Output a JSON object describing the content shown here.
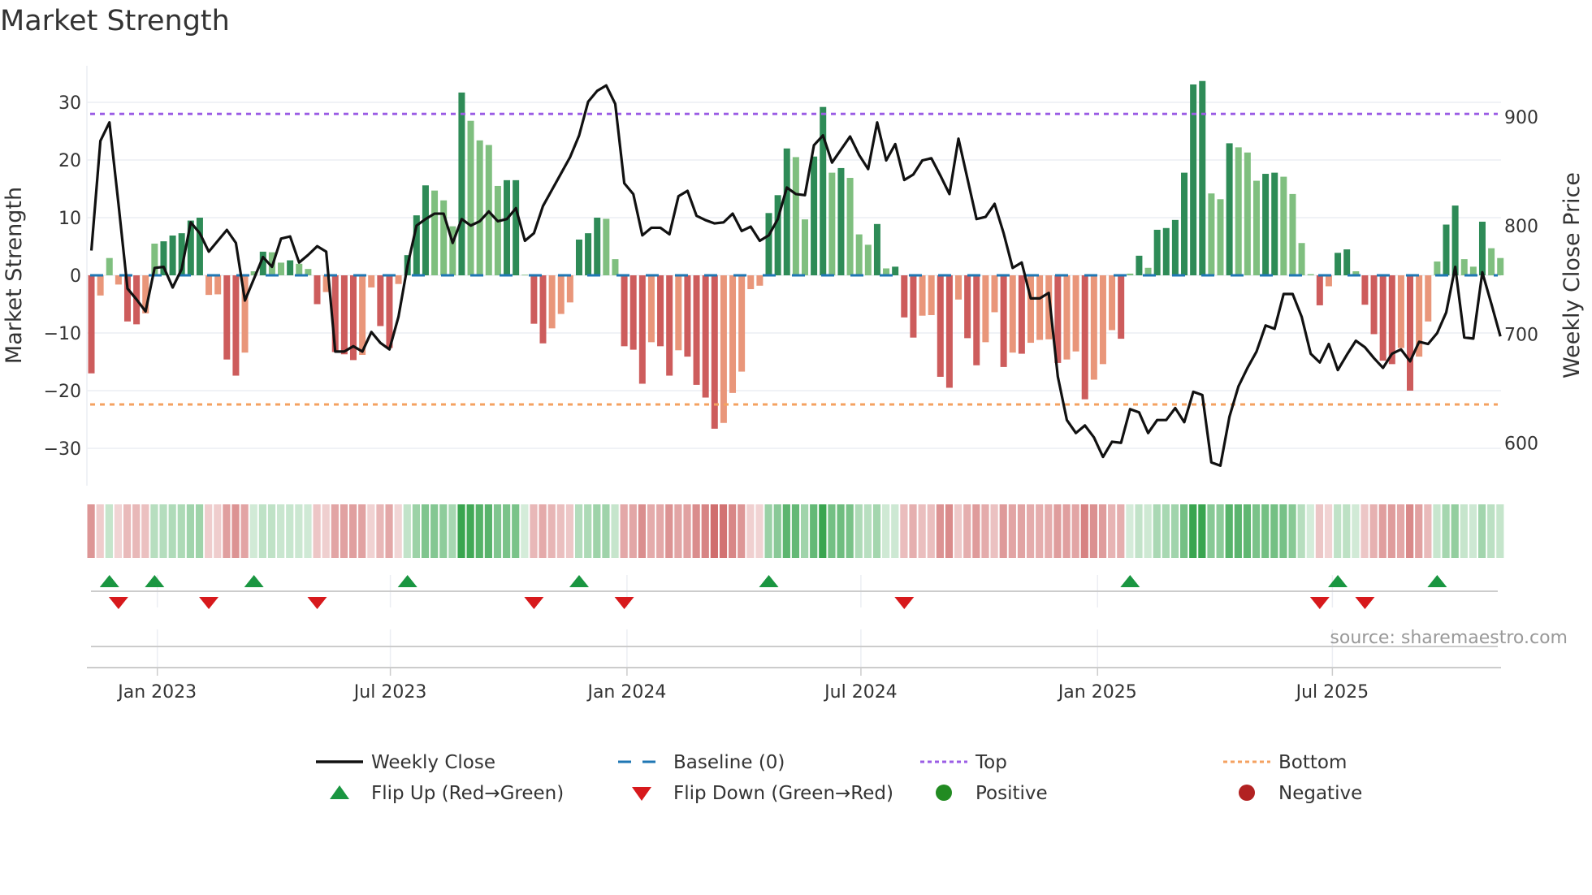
{
  "title": "Market Strength",
  "source": "source: sharemaestro.com",
  "colors": {
    "strong_green": "#2e8b57",
    "weak_green": "#7fbf7f",
    "strong_red": "#cd5c5c",
    "weak_red": "#e9967a",
    "baseline": "#1f77b4",
    "top": "#9b5de5",
    "bottom": "#f4a261",
    "close": "#111111",
    "flip_up": "#1a9641",
    "flip_down": "#d7191c"
  },
  "legend": [
    {
      "label": "Weekly Close"
    },
    {
      "label": "Baseline (0)"
    },
    {
      "label": "Top"
    },
    {
      "label": "Bottom"
    },
    {
      "label": "Flip Up (Red→Green)"
    },
    {
      "label": "Flip Down (Green→Red)"
    },
    {
      "label": "Positive"
    },
    {
      "label": "Negative"
    }
  ],
  "chart_data": {
    "type": "bar",
    "title": "Market Strength",
    "ylabel": "Market Strength",
    "y2label": "Weekly Close Price",
    "ylim": [
      -36.5,
      37
    ],
    "y2lim": [
      570,
      940
    ],
    "yticks": [
      30,
      20,
      10,
      0,
      -10,
      -20,
      -30
    ],
    "yticklabels": [
      "30",
      "20",
      "10",
      "0",
      "−10",
      "−20",
      "−30"
    ],
    "y2ticks": [
      900,
      800,
      700,
      600
    ],
    "y2ticklabels": [
      "900",
      "800",
      "700",
      "600"
    ],
    "xticks": [
      {
        "week": 7.3,
        "label": "Jan 2023"
      },
      {
        "week": 33.1,
        "label": "Jul 2023"
      },
      {
        "week": 59.3,
        "label": "Jan 2024"
      },
      {
        "week": 85.2,
        "label": "Jul 2024"
      },
      {
        "week": 111.4,
        "label": "Jan 2025"
      },
      {
        "week": 137.4,
        "label": "Jul 2025"
      }
    ],
    "top_level": 28,
    "bottom_level": -22.4,
    "baseline": 0,
    "strength": [
      -17,
      -3.5,
      3,
      -1.6,
      -8,
      -8.5,
      -6.6,
      5.5,
      5.9,
      6.9,
      7.3,
      9.5,
      10,
      -3.4,
      -3.3,
      -14.6,
      -17.4,
      -13.4,
      0.7,
      4.1,
      4,
      2.2,
      2.6,
      2,
      1.1,
      -5,
      -2.9,
      -13.3,
      -13.7,
      -14.7,
      -13.8,
      -2.1,
      -8.8,
      -12.6,
      -1.5,
      3.5,
      10.4,
      15.6,
      14.7,
      13,
      8.5,
      31.7,
      26.8,
      23.4,
      22.6,
      15.5,
      16.5,
      16.5,
      0.1,
      -8.4,
      -11.8,
      -9.2,
      -6.7,
      -4.7,
      6.2,
      7.3,
      10,
      9.8,
      2.8,
      -12.3,
      -12.9,
      -18.8,
      -11.6,
      -12.3,
      -17.4,
      -13,
      -14.1,
      -19,
      -21.2,
      -26.6,
      -25.6,
      -20.4,
      -16.7,
      -2.4,
      -1.8,
      10.8,
      13.9,
      22,
      20.5,
      9.7,
      20.6,
      29.2,
      17.8,
      18.6,
      16.9,
      7.1,
      5.3,
      8.9,
      1.2,
      1.5,
      -7.3,
      -10.8,
      -7,
      -6.9,
      -17.6,
      -19.5,
      -4.2,
      -10.9,
      -15.6,
      -11.6,
      -6.4,
      -15.9,
      -13.4,
      -13.6,
      -11.7,
      -11.2,
      -11.1,
      -15.2,
      -14.6,
      -13.2,
      -21.5,
      -18.1,
      -15.4,
      -9.5,
      -11,
      0.3,
      3.4,
      1.3,
      7.9,
      8.2,
      9.6,
      17.8,
      33.1,
      33.7,
      14.2,
      13.2,
      22.9,
      22.2,
      21.3,
      16.4,
      17.6,
      17.8,
      17.1,
      14.1,
      5.6,
      0.2,
      -5.2,
      -1.9,
      3.9,
      4.5,
      0.7,
      -5.1,
      -10.2,
      -14.8,
      -15.4,
      -12.6,
      -20,
      -14.1,
      -8,
      2.4,
      8.8,
      12.1,
      2.8,
      1.5,
      9.3,
      4.7,
      3
    ],
    "weekly_close": [
      777,
      878,
      895,
      820,
      742,
      732,
      721,
      761,
      762,
      743,
      760,
      803,
      793,
      776,
      786,
      796,
      784,
      731,
      751,
      771,
      762,
      788,
      790,
      766,
      773,
      781,
      776,
      684,
      684,
      689,
      684,
      702,
      692,
      686,
      716,
      763,
      800,
      806,
      811,
      811,
      784,
      806,
      800,
      804,
      813,
      804,
      806,
      816,
      786,
      793,
      818,
      833,
      848,
      863,
      883,
      914,
      924,
      929,
      912,
      839,
      829,
      791,
      798,
      798,
      792,
      827,
      832,
      809,
      805,
      802,
      803,
      811,
      795,
      799,
      786,
      791,
      806,
      835,
      829,
      828,
      874,
      883,
      858,
      870,
      882,
      865,
      852,
      895,
      860,
      875,
      842,
      847,
      860,
      862,
      846,
      829,
      880,
      843,
      806,
      808,
      820,
      793,
      761,
      766,
      733,
      733,
      738,
      661,
      621,
      609,
      616,
      605,
      587,
      601,
      600,
      631,
      628,
      609,
      621,
      621,
      632,
      619,
      647,
      644,
      582,
      579,
      624,
      652,
      669,
      684,
      708,
      705,
      737,
      737,
      716,
      682,
      674,
      691,
      667,
      681,
      694,
      688,
      678,
      669,
      682,
      686,
      675,
      693,
      691,
      701,
      720,
      762,
      697,
      696,
      757,
      728,
      698
    ],
    "flip_up_weeks": [
      2,
      7,
      18,
      35,
      54,
      75,
      115,
      138,
      149
    ],
    "flip_down_weeks": [
      3,
      13,
      25,
      49,
      59,
      90,
      136,
      141
    ],
    "grid": true,
    "legend_position": "bottom"
  }
}
